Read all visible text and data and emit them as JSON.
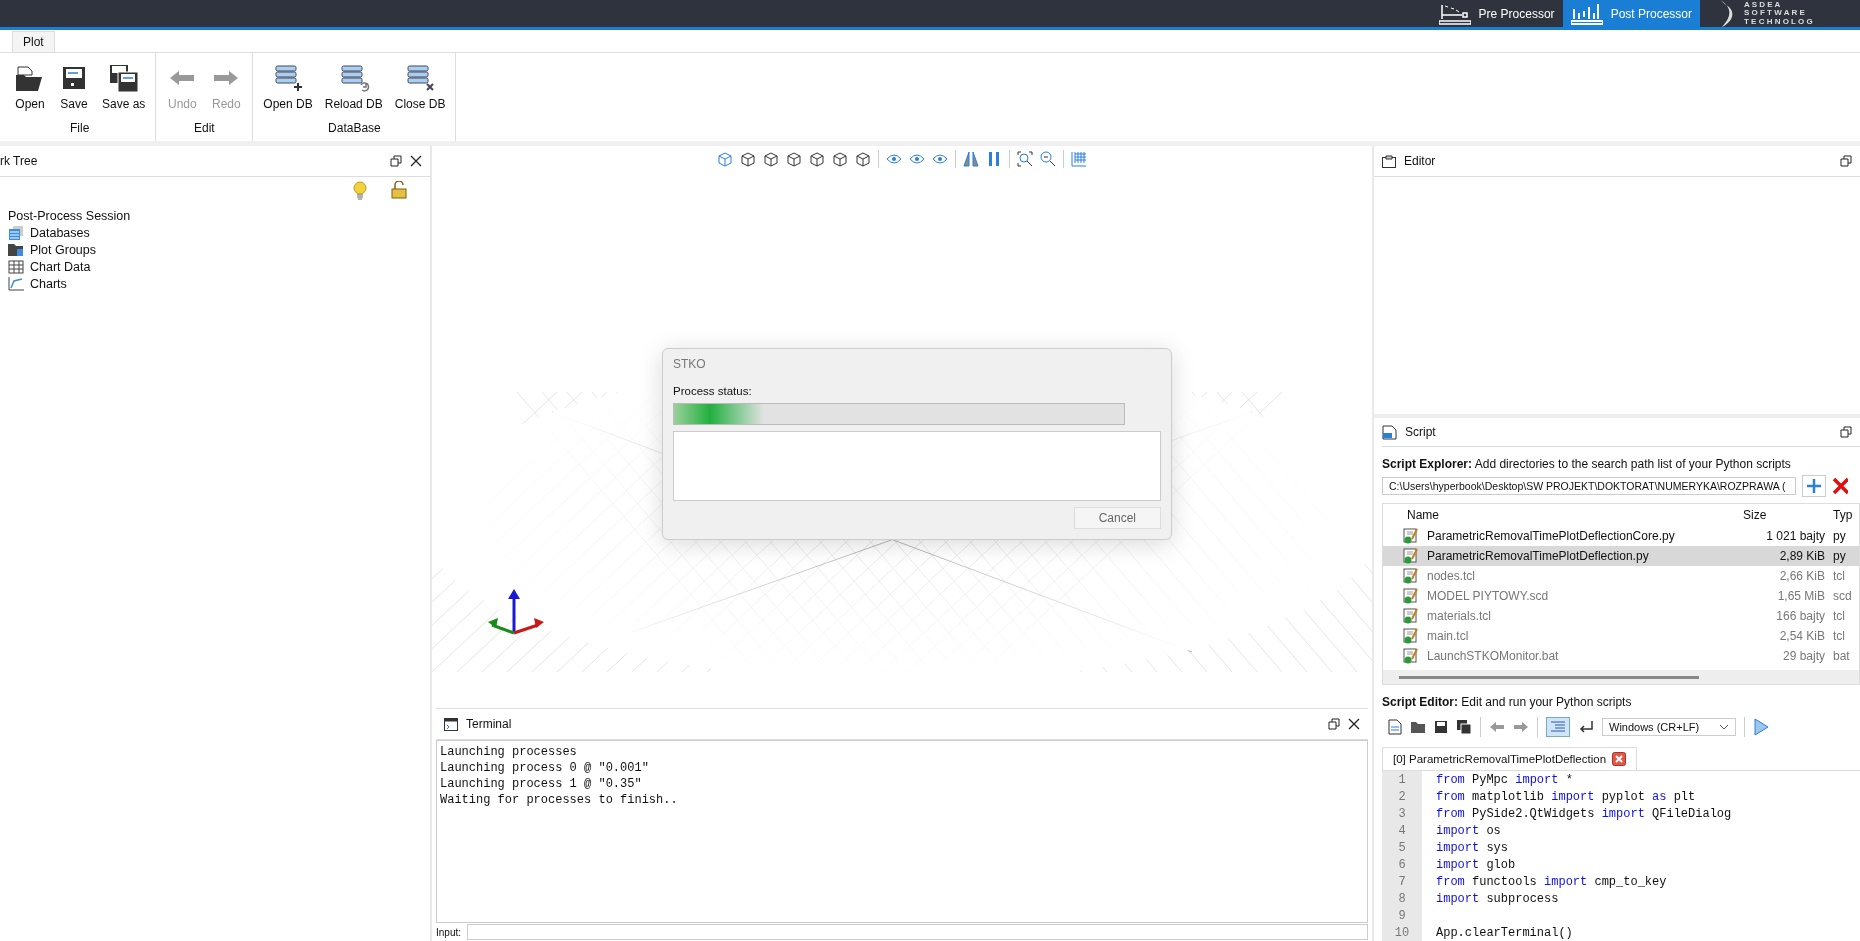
{
  "modes": [
    {
      "label": "Pre Processor",
      "selected": false
    },
    {
      "label": "Post Processor",
      "selected": true
    }
  ],
  "logo": {
    "lines": [
      "A S D E A",
      "S O F T W A R E",
      "T E C H N O L O G"
    ]
  },
  "ribbon_tabs": [
    {
      "label": "Plot"
    }
  ],
  "ribbon_groups": [
    {
      "label": "File",
      "buttons": [
        {
          "label": "Open",
          "kind": "open",
          "disabled": false
        },
        {
          "label": "Save",
          "kind": "save",
          "disabled": false
        },
        {
          "label": "Save as",
          "kind": "saveas",
          "disabled": false
        }
      ]
    },
    {
      "label": "Edit",
      "buttons": [
        {
          "label": "Undo",
          "kind": "undo",
          "disabled": true
        },
        {
          "label": "Redo",
          "kind": "redo",
          "disabled": true
        }
      ]
    },
    {
      "label": "DataBase",
      "buttons": [
        {
          "label": "Open DB",
          "kind": "dbopen",
          "disabled": false
        },
        {
          "label": "Reload DB",
          "kind": "dbreload",
          "disabled": false
        },
        {
          "label": "Close DB",
          "kind": "dbclose",
          "disabled": false
        }
      ]
    }
  ],
  "work_tree": {
    "title": "rk Tree",
    "root": "Post-Process Session",
    "items": [
      {
        "label": "Databases",
        "kind": "databases"
      },
      {
        "label": "Plot Groups",
        "kind": "groups"
      },
      {
        "label": "Chart Data",
        "kind": "table"
      },
      {
        "label": "Charts",
        "kind": "chart"
      }
    ]
  },
  "dialog": {
    "title": "STKO",
    "label": "Process status:",
    "level": 0.2,
    "button": "Cancel"
  },
  "terminal": {
    "title": "Terminal",
    "lines": [
      "Launching processes",
      "Launching process 0 @ \"0.001\"",
      "Launching process 1 @ \"0.35\"",
      "Waiting for processes to finish.."
    ],
    "input_label": "Input:"
  },
  "editor_panel": {
    "title": "Editor"
  },
  "script_panel": {
    "title": "Script",
    "explorer_label": "Script Explorer:",
    "explorer_hint": "Add directories to the search path list of your Python scripts",
    "path": "C:\\Users\\hyperbook\\Desktop\\SW PROJEKT\\DOKTORAT\\NUMERYKA\\ROZPRAWA (",
    "columns": [
      "Name",
      "Size",
      "Typ"
    ],
    "files": [
      {
        "name": "ParametricRemovalTimePlotDeflectionCore.py",
        "size": "1 021 bajty",
        "type": "py",
        "selected": false,
        "dimmed": false
      },
      {
        "name": "ParametricRemovalTimePlotDeflection.py",
        "size": "2,89 KiB",
        "type": "py",
        "selected": true,
        "dimmed": false
      },
      {
        "name": "nodes.tcl",
        "size": "2,66 KiB",
        "type": "tcl",
        "selected": false,
        "dimmed": true
      },
      {
        "name": "MODEL PIYTOWY.scd",
        "size": "1,65 MiB",
        "type": "scd",
        "selected": false,
        "dimmed": true
      },
      {
        "name": "materials.tcl",
        "size": "166 bajty",
        "type": "tcl",
        "selected": false,
        "dimmed": true
      },
      {
        "name": "main.tcl",
        "size": "2,54 KiB",
        "type": "tcl",
        "selected": false,
        "dimmed": true
      },
      {
        "name": "LaunchSTKOMonitor.bat",
        "size": "29 bajty",
        "type": "bat",
        "selected": false,
        "dimmed": true
      }
    ],
    "editor_label": "Script Editor:",
    "editor_hint": "Edit and run your Python scripts",
    "line_ending": "Windows (CR+LF)",
    "tab": "[0] ParametricRemovalTimePlotDeflection",
    "code": [
      {
        "number": "1",
        "tokens": [
          {
            "text": "from",
            "kind": "keyword"
          },
          {
            "text": " PyMpc ",
            "kind": "plain"
          },
          {
            "text": "import",
            "kind": "keyword"
          },
          {
            "text": " *",
            "kind": "plain"
          }
        ]
      },
      {
        "number": "2",
        "tokens": [
          {
            "text": "from",
            "kind": "keyword"
          },
          {
            "text": " matplotlib ",
            "kind": "plain"
          },
          {
            "text": "import",
            "kind": "keyword"
          },
          {
            "text": " pyplot ",
            "kind": "plain"
          },
          {
            "text": "as",
            "kind": "keyword"
          },
          {
            "text": " plt",
            "kind": "plain"
          }
        ]
      },
      {
        "number": "3",
        "tokens": [
          {
            "text": "from",
            "kind": "keyword"
          },
          {
            "text": " PySide2.QtWidgets ",
            "kind": "plain"
          },
          {
            "text": "import",
            "kind": "keyword"
          },
          {
            "text": " QFileDialog",
            "kind": "plain"
          }
        ]
      },
      {
        "number": "4",
        "tokens": [
          {
            "text": "import",
            "kind": "keyword"
          },
          {
            "text": " os",
            "kind": "plain"
          }
        ]
      },
      {
        "number": "5",
        "tokens": [
          {
            "text": "import",
            "kind": "keyword"
          },
          {
            "text": " sys",
            "kind": "plain"
          }
        ]
      },
      {
        "number": "6",
        "tokens": [
          {
            "text": "import",
            "kind": "keyword"
          },
          {
            "text": " glob",
            "kind": "plain"
          }
        ]
      },
      {
        "number": "7",
        "tokens": [
          {
            "text": "from",
            "kind": "keyword"
          },
          {
            "text": " functools ",
            "kind": "plain"
          },
          {
            "text": "import",
            "kind": "keyword"
          },
          {
            "text": " cmp_to_key",
            "kind": "plain"
          }
        ]
      },
      {
        "number": "8",
        "tokens": [
          {
            "text": "import",
            "kind": "keyword"
          },
          {
            "text": " subprocess",
            "kind": "plain"
          }
        ]
      },
      {
        "number": "9"
      },
      {
        "number": "10",
        "tokens": [
          {
            "text": "App.clearTerminal()",
            "kind": "plain"
          }
        ]
      }
    ]
  }
}
